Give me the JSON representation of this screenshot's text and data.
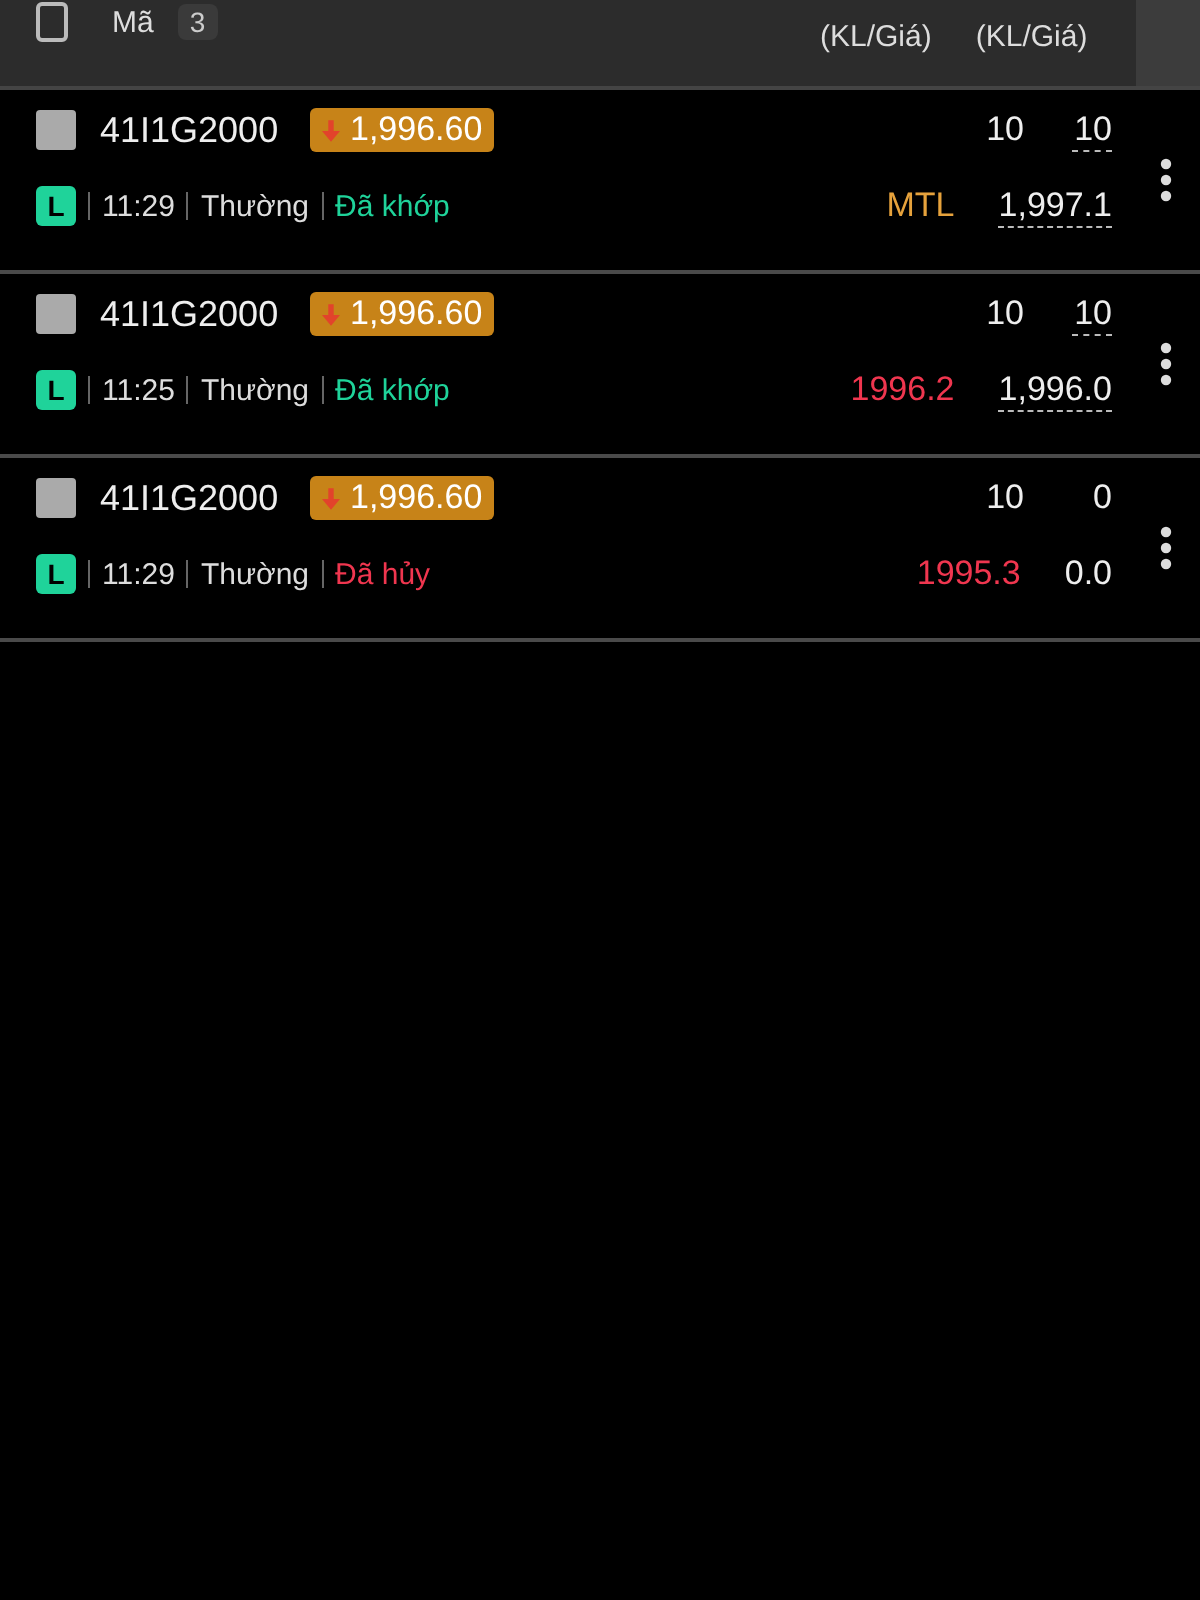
{
  "header": {
    "checked": false,
    "label": "Mã",
    "count": "3",
    "columns": [
      "(KL/Giá)",
      "(KL/Giá)"
    ]
  },
  "orders": [
    {
      "checked": false,
      "code": "41I1G2000",
      "price_badge": "1,996.60",
      "type": "L",
      "time": "11:29",
      "session": "Thường",
      "status": {
        "text": "Đã khớp",
        "color": "#1fd39a"
      },
      "order_qty": "10",
      "order_price": {
        "text": "MTL",
        "color": "#e6a23c"
      },
      "match_qty": "10",
      "match_price": "1,997.1",
      "underlined": true
    },
    {
      "checked": false,
      "code": "41I1G2000",
      "price_badge": "1,996.60",
      "type": "L",
      "time": "11:25",
      "session": "Thường",
      "status": {
        "text": "Đã khớp",
        "color": "#1fd39a"
      },
      "order_qty": "10",
      "order_price": {
        "text": "1996.2",
        "color": "#f0364f"
      },
      "match_qty": "10",
      "match_price": "1,996.0",
      "underlined": true
    },
    {
      "checked": false,
      "code": "41I1G2000",
      "price_badge": "1,996.60",
      "type": "L",
      "time": "11:29",
      "session": "Thường",
      "status": {
        "text": "Đã hủy",
        "color": "#f0364f"
      },
      "order_qty": "10",
      "order_price": {
        "text": "1995.3",
        "color": "#f0364f"
      },
      "match_qty": "0",
      "match_price": "0.0",
      "underlined": false
    }
  ]
}
